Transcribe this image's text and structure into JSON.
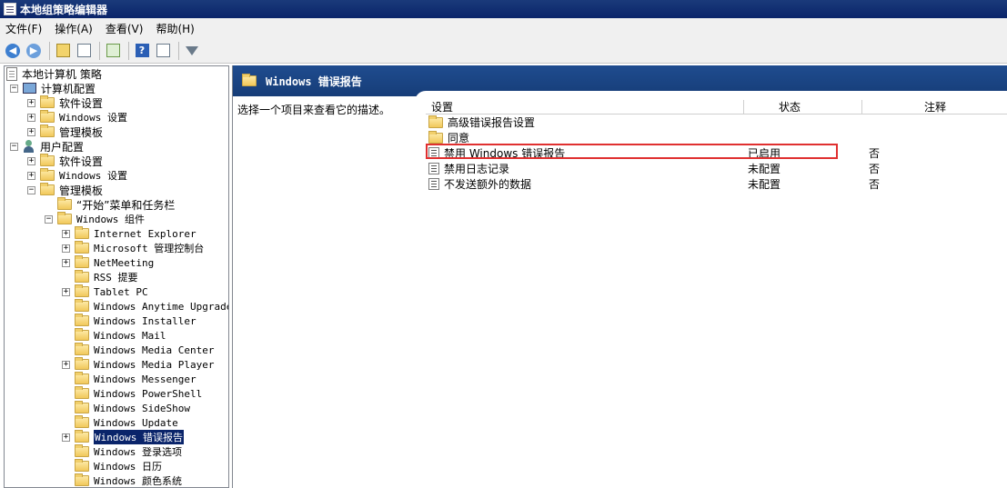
{
  "window": {
    "title": "本地组策略编辑器"
  },
  "menu": [
    {
      "label": "文件(F)"
    },
    {
      "label": "操作(A)"
    },
    {
      "label": "查看(V)"
    },
    {
      "label": "帮助(H)"
    }
  ],
  "toolbar": {
    "icons": [
      "back-arrow-icon",
      "forward-arrow-icon",
      "up-folder-icon",
      "show-hide-tree-icon",
      "export-list-icon",
      "help-icon",
      "properties-icon",
      "filter-icon"
    ]
  },
  "tree": {
    "root": "本地计算机 策略",
    "computer_config": "计算机配置",
    "cc_software": "软件设置",
    "cc_windows": "Windows 设置",
    "cc_admin": "管理模板",
    "user_config": "用户配置",
    "uc_software": "软件设置",
    "uc_windows": "Windows 设置",
    "uc_admin": "管理模板",
    "start_menu": "“开始”菜单和任务栏",
    "windows_components": "Windows 组件",
    "components": [
      {
        "label": "Internet Explorer",
        "expandable": true
      },
      {
        "label": "Microsoft 管理控制台",
        "expandable": true
      },
      {
        "label": "NetMeeting",
        "expandable": true
      },
      {
        "label": "RSS 提要",
        "expandable": false
      },
      {
        "label": "Tablet PC",
        "expandable": true
      },
      {
        "label": "Windows Anytime Upgrade",
        "expandable": false
      },
      {
        "label": "Windows Installer",
        "expandable": false
      },
      {
        "label": "Windows Mail",
        "expandable": false
      },
      {
        "label": "Windows Media Center",
        "expandable": false
      },
      {
        "label": "Windows Media Player",
        "expandable": true
      },
      {
        "label": "Windows Messenger",
        "expandable": false
      },
      {
        "label": "Windows PowerShell",
        "expandable": false
      },
      {
        "label": "Windows SideShow",
        "expandable": false
      },
      {
        "label": "Windows Update",
        "expandable": false
      },
      {
        "label": "Windows 错误报告",
        "expandable": true,
        "selected": true
      },
      {
        "label": "Windows 登录选项",
        "expandable": false
      },
      {
        "label": "Windows 日历",
        "expandable": false
      },
      {
        "label": "Windows 颜色系统",
        "expandable": false
      }
    ]
  },
  "right": {
    "header": "Windows 错误报告",
    "description": "选择一个项目来查看它的描述。",
    "columns": [
      "设置",
      "状态",
      "注释"
    ],
    "rows": [
      {
        "type": "folder",
        "name": "高级错误报告设置",
        "state": "",
        "comment": ""
      },
      {
        "type": "folder",
        "name": "同意",
        "state": "",
        "comment": ""
      },
      {
        "type": "setting",
        "name": "禁用 Windows 错误报告",
        "state": "已启用",
        "comment": "否"
      },
      {
        "type": "setting",
        "name": "禁用日志记录",
        "state": "未配置",
        "comment": "否"
      },
      {
        "type": "setting",
        "name": "不发送额外的数据",
        "state": "未配置",
        "comment": "否"
      }
    ]
  },
  "colors": {
    "title_bar": "#0a246a",
    "selection": "#0a246a",
    "highlight_border": "#e03030"
  }
}
